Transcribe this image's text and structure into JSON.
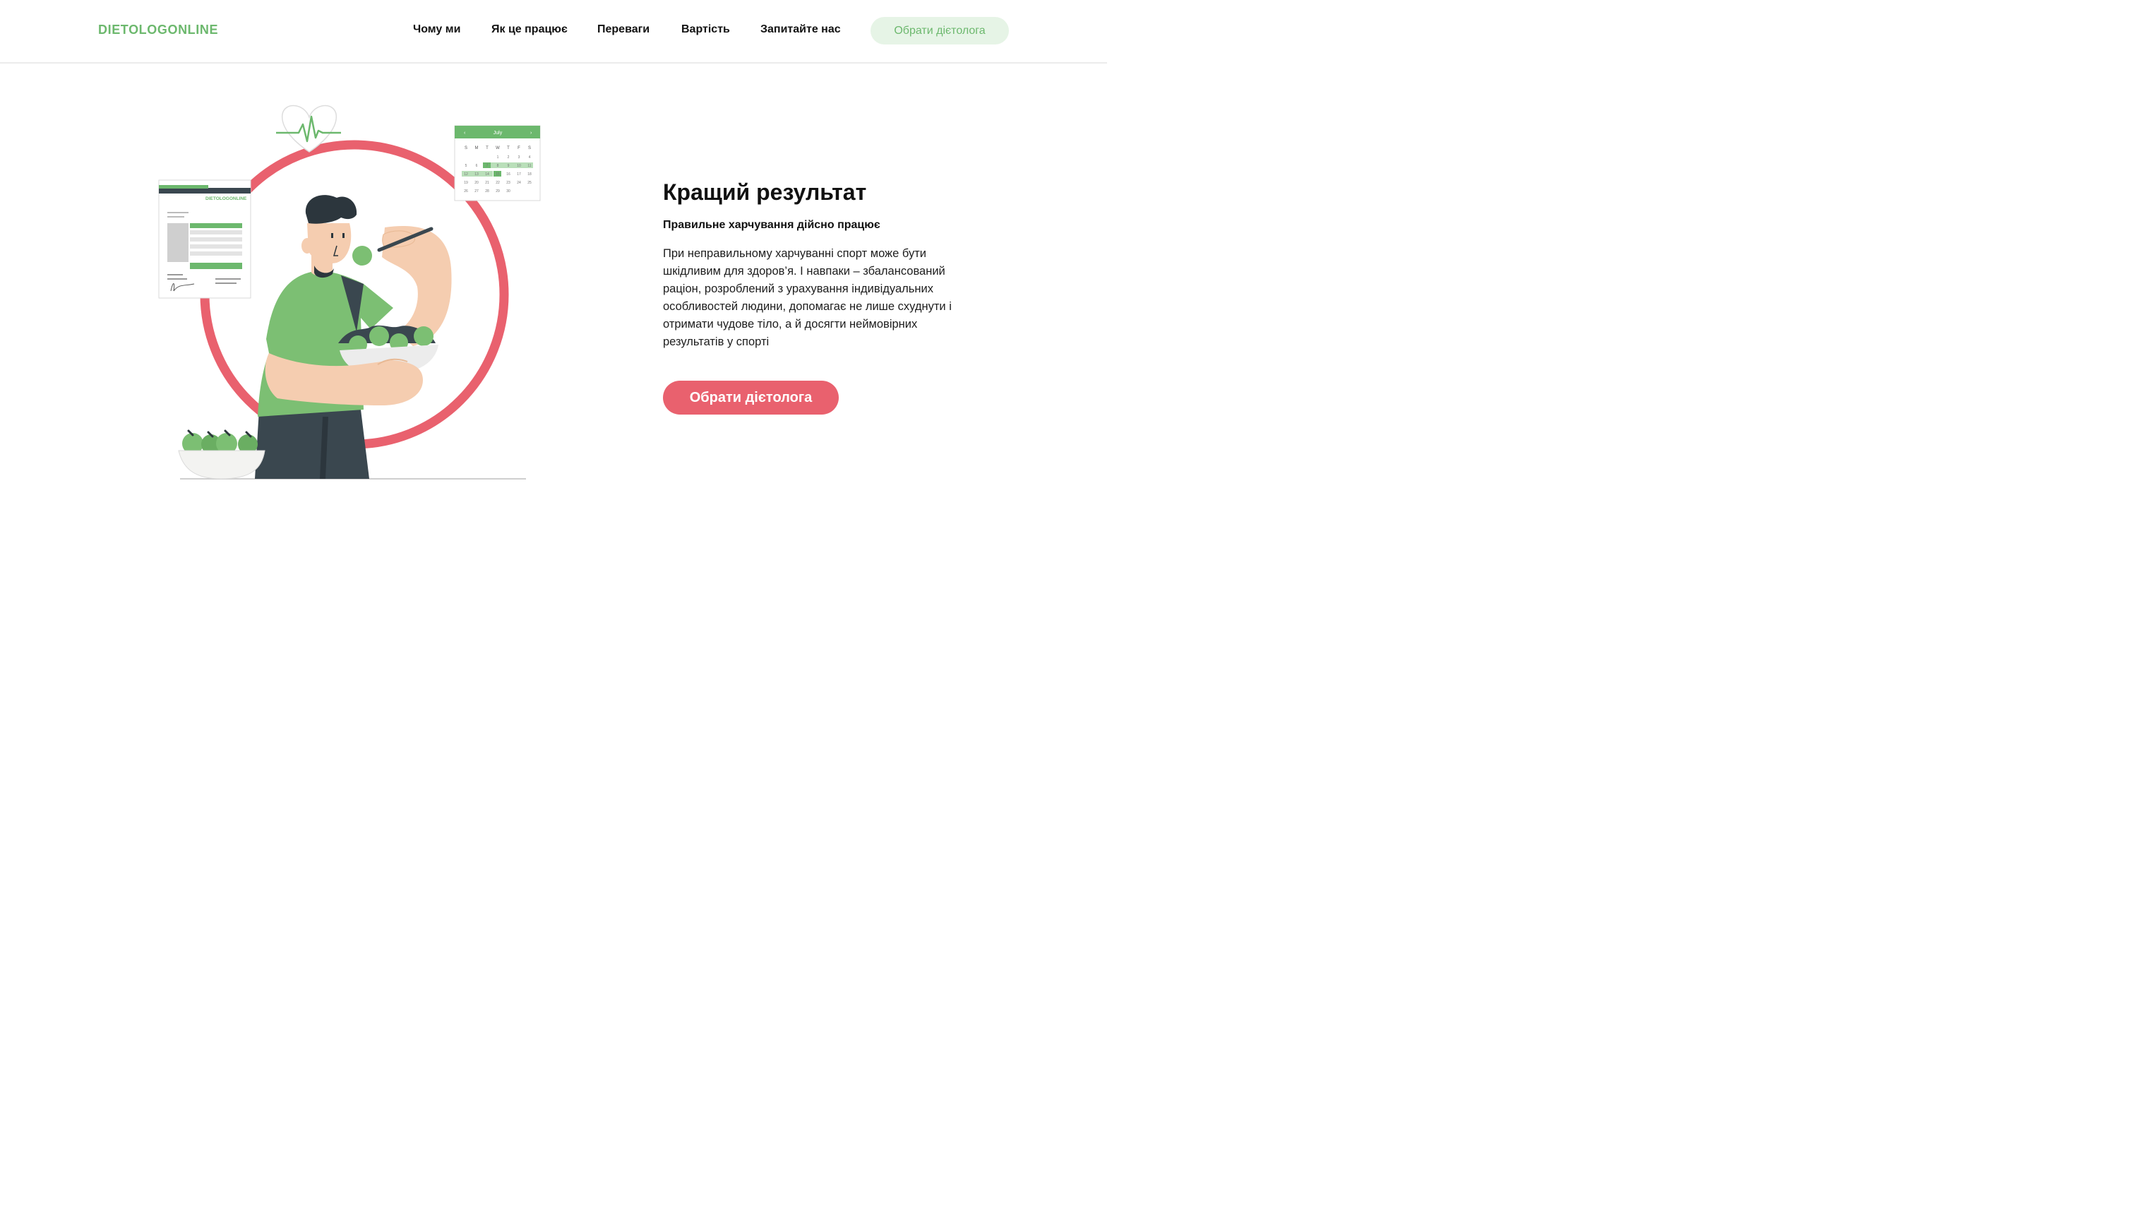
{
  "header": {
    "logo": "DIETOLOGONLINE",
    "nav": [
      "Чому ми",
      "Як це працює",
      "Переваги",
      "Вартість",
      "Запитайте нас"
    ],
    "cta_label": "Обрати дієтолога"
  },
  "hero": {
    "title": "Кращий результат",
    "subtitle": "Правильне харчування дійсно працює",
    "body": "При неправильному харчуванні спорт може бути шкідливим для здоров’я. І навпаки – збалансований раціон, розроблений з урахування індивідуальних особливостей людини, допомагає не лише схуднути і отримати чудове тіло, а й досягти неймовірних результатів у спорті",
    "cta_label": "Обрати дієтолога"
  },
  "illustration": {
    "calendar_month": "July",
    "calendar_days": [
      "S",
      "M",
      "T",
      "W",
      "T",
      "F",
      "S"
    ],
    "calendar_dates": [
      "1",
      "2",
      "3",
      "4",
      "5",
      "6",
      "7",
      "8",
      "9",
      "10",
      "11",
      "12",
      "13",
      "14",
      "15",
      "16",
      "17",
      "18",
      "19",
      "20",
      "21",
      "22",
      "23",
      "24",
      "25",
      "26",
      "27",
      "28",
      "29",
      "30"
    ],
    "document_logo": "DIETOLOGONLINE",
    "icons": [
      "heart-pulse-icon",
      "calendar-icon",
      "document-icon"
    ]
  },
  "colors": {
    "brand_green": "#6cb86d",
    "light_green": "#e6f4e6",
    "accent_red": "#e9616e",
    "dark": "#3a474f",
    "skin": "#f5cdb0"
  }
}
